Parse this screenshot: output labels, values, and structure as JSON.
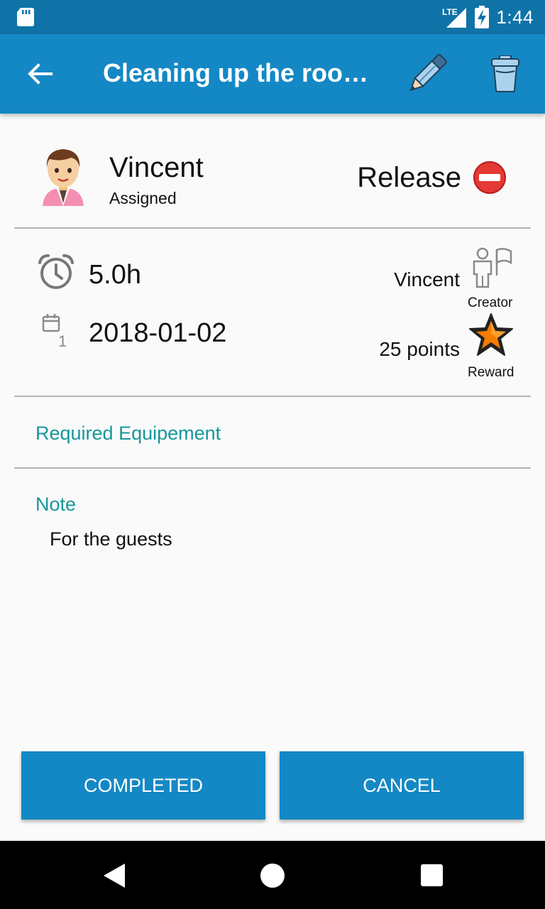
{
  "status_bar": {
    "network": "LTE",
    "time": "1:44",
    "icons": [
      "sd-card-icon",
      "signal-icon",
      "battery-charging-icon"
    ]
  },
  "app_bar": {
    "title": "Cleaning up the roo…",
    "icons": [
      "back-arrow-icon",
      "pencil-icon",
      "trash-icon"
    ]
  },
  "assignee": {
    "name": "Vincent",
    "role": "Assigned",
    "release_label": "Release",
    "icons": [
      "avatar-icon",
      "no-entry-icon"
    ]
  },
  "task_info": {
    "duration": "5.0h",
    "date": "2018-01-02",
    "creator_name": "Vincent",
    "creator_label": "Creator",
    "reward_points": "25 points",
    "reward_label": "Reward",
    "icons": [
      "alarm-clock-icon",
      "calendar-icon",
      "creator-icon",
      "star-icon"
    ]
  },
  "sections": {
    "equipment_title": "Required Equipement",
    "note_title": "Note",
    "note_text": "For the guests"
  },
  "actions": {
    "completed_label": "COMPLETED",
    "cancel_label": "CANCEL"
  },
  "colors": {
    "app_bar": "#1488c4",
    "status_bar": "#0f73a8",
    "section_title": "#15979a",
    "button": "#1488c4"
  }
}
